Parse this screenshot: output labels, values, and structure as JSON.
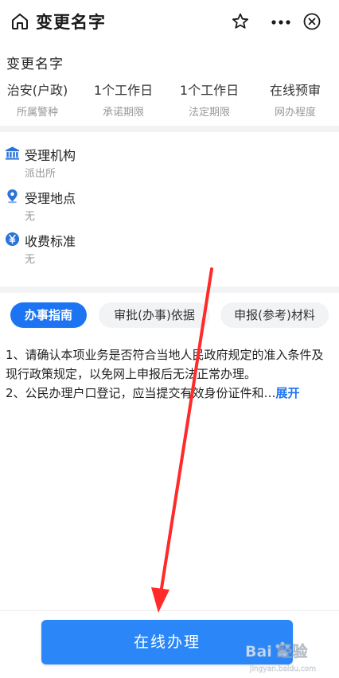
{
  "header": {
    "title": "变更名字"
  },
  "service": {
    "name": "变更名字",
    "stats": [
      {
        "value": "治安(户政)",
        "label": "所属警种"
      },
      {
        "value": "1个工作日",
        "label": "承诺期限"
      },
      {
        "value": "1个工作日",
        "label": "法定期限"
      },
      {
        "value": "在线预审",
        "label": "网办程度"
      }
    ]
  },
  "info": [
    {
      "icon": "bank-icon",
      "title": "受理机构",
      "sub": "派出所"
    },
    {
      "icon": "location-pin-icon",
      "title": "受理地点",
      "sub": "无"
    },
    {
      "icon": "yuan-icon",
      "title": "收费标准",
      "sub": "无"
    }
  ],
  "tabs": [
    {
      "label": "办事指南",
      "active": true
    },
    {
      "label": "审批(办事)依据",
      "active": false
    },
    {
      "label": "申报(参考)材料",
      "active": false
    }
  ],
  "guide": {
    "line1": "1、请确认本项业务是否符合当地人民政府规定的准入条件及现行政策规定，以免网上申报后无法正常办理。",
    "line2": "2、公民办理户口登记，应当提交有效身份证件和…",
    "expand": "展开"
  },
  "bottom": {
    "apply_label": "在线办理"
  },
  "watermark": {
    "brand": "Bai 经验",
    "url": "jingyan.baidu.com"
  },
  "colors": {
    "accent": "#1d74f2",
    "button": "#2b86f7",
    "annotation": "#ff2a2a"
  }
}
